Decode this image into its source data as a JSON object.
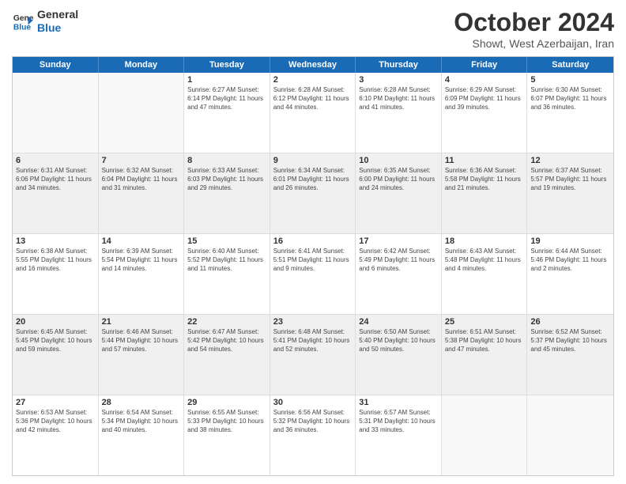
{
  "header": {
    "logo_line1": "General",
    "logo_line2": "Blue",
    "month": "October 2024",
    "location": "Showt, West Azerbaijan, Iran"
  },
  "weekdays": [
    "Sunday",
    "Monday",
    "Tuesday",
    "Wednesday",
    "Thursday",
    "Friday",
    "Saturday"
  ],
  "rows": [
    [
      {
        "day": "",
        "info": "",
        "shaded": false,
        "empty": true
      },
      {
        "day": "",
        "info": "",
        "shaded": false,
        "empty": true
      },
      {
        "day": "1",
        "info": "Sunrise: 6:27 AM\nSunset: 6:14 PM\nDaylight: 11 hours and 47 minutes.",
        "shaded": false,
        "empty": false
      },
      {
        "day": "2",
        "info": "Sunrise: 6:28 AM\nSunset: 6:12 PM\nDaylight: 11 hours and 44 minutes.",
        "shaded": false,
        "empty": false
      },
      {
        "day": "3",
        "info": "Sunrise: 6:28 AM\nSunset: 6:10 PM\nDaylight: 11 hours and 41 minutes.",
        "shaded": false,
        "empty": false
      },
      {
        "day": "4",
        "info": "Sunrise: 6:29 AM\nSunset: 6:09 PM\nDaylight: 11 hours and 39 minutes.",
        "shaded": false,
        "empty": false
      },
      {
        "day": "5",
        "info": "Sunrise: 6:30 AM\nSunset: 6:07 PM\nDaylight: 11 hours and 36 minutes.",
        "shaded": false,
        "empty": false
      }
    ],
    [
      {
        "day": "6",
        "info": "Sunrise: 6:31 AM\nSunset: 6:06 PM\nDaylight: 11 hours and 34 minutes.",
        "shaded": true,
        "empty": false
      },
      {
        "day": "7",
        "info": "Sunrise: 6:32 AM\nSunset: 6:04 PM\nDaylight: 11 hours and 31 minutes.",
        "shaded": true,
        "empty": false
      },
      {
        "day": "8",
        "info": "Sunrise: 6:33 AM\nSunset: 6:03 PM\nDaylight: 11 hours and 29 minutes.",
        "shaded": true,
        "empty": false
      },
      {
        "day": "9",
        "info": "Sunrise: 6:34 AM\nSunset: 6:01 PM\nDaylight: 11 hours and 26 minutes.",
        "shaded": true,
        "empty": false
      },
      {
        "day": "10",
        "info": "Sunrise: 6:35 AM\nSunset: 6:00 PM\nDaylight: 11 hours and 24 minutes.",
        "shaded": true,
        "empty": false
      },
      {
        "day": "11",
        "info": "Sunrise: 6:36 AM\nSunset: 5:58 PM\nDaylight: 11 hours and 21 minutes.",
        "shaded": true,
        "empty": false
      },
      {
        "day": "12",
        "info": "Sunrise: 6:37 AM\nSunset: 5:57 PM\nDaylight: 11 hours and 19 minutes.",
        "shaded": true,
        "empty": false
      }
    ],
    [
      {
        "day": "13",
        "info": "Sunrise: 6:38 AM\nSunset: 5:55 PM\nDaylight: 11 hours and 16 minutes.",
        "shaded": false,
        "empty": false
      },
      {
        "day": "14",
        "info": "Sunrise: 6:39 AM\nSunset: 5:54 PM\nDaylight: 11 hours and 14 minutes.",
        "shaded": false,
        "empty": false
      },
      {
        "day": "15",
        "info": "Sunrise: 6:40 AM\nSunset: 5:52 PM\nDaylight: 11 hours and 11 minutes.",
        "shaded": false,
        "empty": false
      },
      {
        "day": "16",
        "info": "Sunrise: 6:41 AM\nSunset: 5:51 PM\nDaylight: 11 hours and 9 minutes.",
        "shaded": false,
        "empty": false
      },
      {
        "day": "17",
        "info": "Sunrise: 6:42 AM\nSunset: 5:49 PM\nDaylight: 11 hours and 6 minutes.",
        "shaded": false,
        "empty": false
      },
      {
        "day": "18",
        "info": "Sunrise: 6:43 AM\nSunset: 5:48 PM\nDaylight: 11 hours and 4 minutes.",
        "shaded": false,
        "empty": false
      },
      {
        "day": "19",
        "info": "Sunrise: 6:44 AM\nSunset: 5:46 PM\nDaylight: 11 hours and 2 minutes.",
        "shaded": false,
        "empty": false
      }
    ],
    [
      {
        "day": "20",
        "info": "Sunrise: 6:45 AM\nSunset: 5:45 PM\nDaylight: 10 hours and 59 minutes.",
        "shaded": true,
        "empty": false
      },
      {
        "day": "21",
        "info": "Sunrise: 6:46 AM\nSunset: 5:44 PM\nDaylight: 10 hours and 57 minutes.",
        "shaded": true,
        "empty": false
      },
      {
        "day": "22",
        "info": "Sunrise: 6:47 AM\nSunset: 5:42 PM\nDaylight: 10 hours and 54 minutes.",
        "shaded": true,
        "empty": false
      },
      {
        "day": "23",
        "info": "Sunrise: 6:48 AM\nSunset: 5:41 PM\nDaylight: 10 hours and 52 minutes.",
        "shaded": true,
        "empty": false
      },
      {
        "day": "24",
        "info": "Sunrise: 6:50 AM\nSunset: 5:40 PM\nDaylight: 10 hours and 50 minutes.",
        "shaded": true,
        "empty": false
      },
      {
        "day": "25",
        "info": "Sunrise: 6:51 AM\nSunset: 5:38 PM\nDaylight: 10 hours and 47 minutes.",
        "shaded": true,
        "empty": false
      },
      {
        "day": "26",
        "info": "Sunrise: 6:52 AM\nSunset: 5:37 PM\nDaylight: 10 hours and 45 minutes.",
        "shaded": true,
        "empty": false
      }
    ],
    [
      {
        "day": "27",
        "info": "Sunrise: 6:53 AM\nSunset: 5:36 PM\nDaylight: 10 hours and 42 minutes.",
        "shaded": false,
        "empty": false
      },
      {
        "day": "28",
        "info": "Sunrise: 6:54 AM\nSunset: 5:34 PM\nDaylight: 10 hours and 40 minutes.",
        "shaded": false,
        "empty": false
      },
      {
        "day": "29",
        "info": "Sunrise: 6:55 AM\nSunset: 5:33 PM\nDaylight: 10 hours and 38 minutes.",
        "shaded": false,
        "empty": false
      },
      {
        "day": "30",
        "info": "Sunrise: 6:56 AM\nSunset: 5:32 PM\nDaylight: 10 hours and 36 minutes.",
        "shaded": false,
        "empty": false
      },
      {
        "day": "31",
        "info": "Sunrise: 6:57 AM\nSunset: 5:31 PM\nDaylight: 10 hours and 33 minutes.",
        "shaded": false,
        "empty": false
      },
      {
        "day": "",
        "info": "",
        "shaded": false,
        "empty": true
      },
      {
        "day": "",
        "info": "",
        "shaded": false,
        "empty": true
      }
    ]
  ]
}
